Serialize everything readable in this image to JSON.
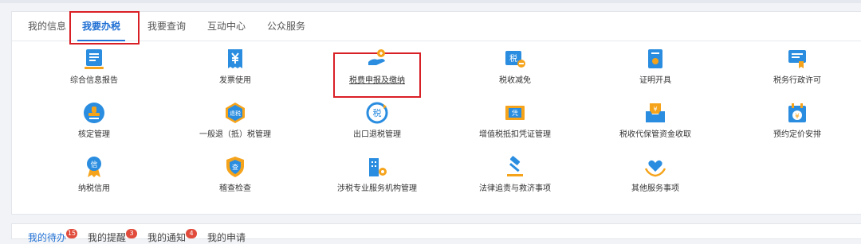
{
  "tabs": [
    "我的信息",
    "我要办税",
    "我要查询",
    "互动中心",
    "公众服务"
  ],
  "services": [
    {
      "label": "综合信息报告",
      "icon": "report-document-icon"
    },
    {
      "label": "发票使用",
      "icon": "invoice-yuan-icon"
    },
    {
      "label": "税费申报及缴纳",
      "icon": "hand-coin-icon"
    },
    {
      "label": "税收减免",
      "icon": "tax-reduction-icon"
    },
    {
      "label": "证明开具",
      "icon": "certificate-icon"
    },
    {
      "label": "税务行政许可",
      "icon": "admin-license-icon"
    },
    {
      "label": "核定管理",
      "icon": "stamp-icon"
    },
    {
      "label": "一般退（抵）税管理",
      "icon": "tax-refund-icon"
    },
    {
      "label": "出口退税管理",
      "icon": "export-refund-icon"
    },
    {
      "label": "增值税抵扣凭证管理",
      "icon": "voucher-icon"
    },
    {
      "label": "税收代保管资金收取",
      "icon": "custody-fund-icon"
    },
    {
      "label": "预约定价安排",
      "icon": "calendar-yuan-icon"
    },
    {
      "label": "纳税信用",
      "icon": "credit-medal-icon"
    },
    {
      "label": "稽查检查",
      "icon": "inspection-shield-icon"
    },
    {
      "label": "涉税专业服务机构管理",
      "icon": "agency-building-icon"
    },
    {
      "label": "法律追责与救济事项",
      "icon": "gavel-icon"
    },
    {
      "label": "其他服务事项",
      "icon": "heart-hands-icon"
    }
  ],
  "bottom_tabs": [
    {
      "label": "我的待办",
      "badge": "15"
    },
    {
      "label": "我的提醒",
      "badge": "3"
    },
    {
      "label": "我的通知",
      "badge": "4"
    },
    {
      "label": "我的申请",
      "badge": ""
    }
  ],
  "colors": {
    "accent": "#1f6fd4",
    "highlight_box": "#d91f26",
    "icon_blue": "#2a8de0",
    "icon_orange": "#f5a31a"
  }
}
